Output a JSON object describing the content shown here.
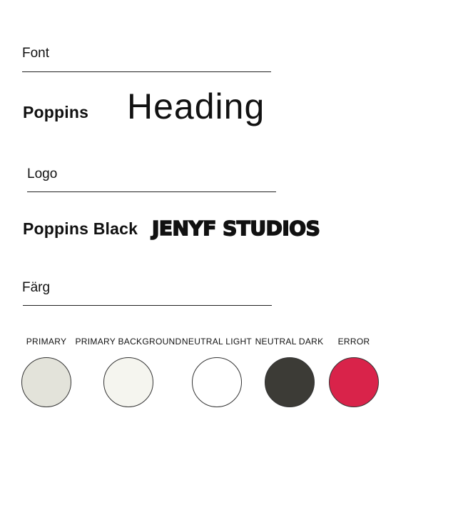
{
  "font_section": {
    "label": "Font",
    "font_name": "Poppins",
    "sample": "Heading"
  },
  "logo_section": {
    "label": "Logo",
    "font_name": "Poppins Black",
    "sample": "JENYF STUDIOS"
  },
  "color_section": {
    "label": "Färg",
    "swatches": [
      {
        "label": "PRIMARY",
        "color": "#e3e3da"
      },
      {
        "label": "PRIMARY BACKGROUND",
        "color": "#f5f5ef"
      },
      {
        "label": "NEUTRAL LIGHT",
        "color": "#ffffff"
      },
      {
        "label": "NEUTRAL DARK",
        "color": "#3c3b36"
      },
      {
        "label": "ERROR",
        "color": "#d9234a"
      }
    ]
  }
}
